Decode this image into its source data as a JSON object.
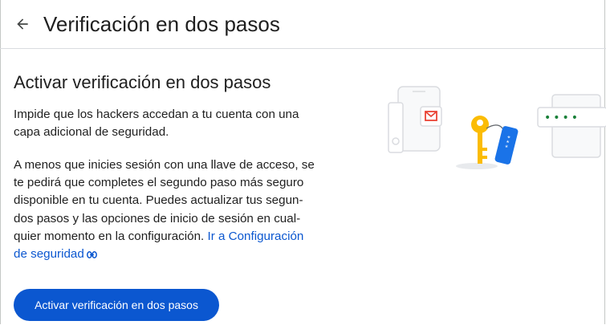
{
  "header": {
    "back_icon": "arrow-back-icon",
    "title": "Verificación en dos pasos"
  },
  "main": {
    "section_title": "Activar verificación en dos pasos",
    "paragraph1_lines": [
      "Impide que los hackers accedan a tu cuenta con una",
      "capa adicional de seguridad."
    ],
    "paragraph2_lines": [
      "A menos que inicies sesión con una llave de acceso, se",
      "te pedirá que completes el segundo paso más seguro",
      "disponible en tu cuenta. Puedes actualizar tus segun-",
      "dos pasos y las opciones de inicio de sesión en cual-"
    ],
    "paragraph2_last_prefix": "quier momento en la configuración.",
    "link_line1": "Ir a Configuración",
    "link_line2": "de seguridad",
    "link_icon": "link-icon",
    "button_label": "Activar verificación en dos pasos"
  },
  "illustration": {
    "icons": [
      "phone-icon",
      "email-icon",
      "usb-key-icon",
      "key-icon",
      "password-window-icon"
    ],
    "password_mask": "••••",
    "tag_mask": "* * *"
  },
  "colors": {
    "primary": "#0b57d0",
    "text": "#1f1f1f",
    "key_yellow": "#fbbc04",
    "tag_blue": "#1a73e8",
    "email_red": "#ea4335",
    "dots_green": "#188038",
    "outline_gray": "#dadce0"
  }
}
